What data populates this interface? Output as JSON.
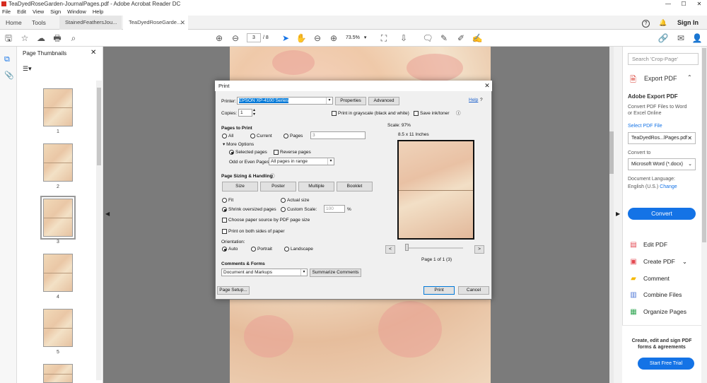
{
  "window": {
    "title": "TeaDyedRoseGarden-JournalPages.pdf - Adobe Acrobat Reader DC",
    "controls": [
      "—",
      "☐",
      "✕"
    ]
  },
  "menu": [
    "File",
    "Edit",
    "View",
    "Sign",
    "Window",
    "Help"
  ],
  "tabs": {
    "home": "Home",
    "tools": "Tools",
    "doc1": "StainedFeathersJou...",
    "doc2": "TeaDyedRoseGarde...",
    "help_icon": "?",
    "signin": "Sign In"
  },
  "toolbar": {
    "page_current": "3",
    "page_total": "/ 8",
    "zoom": "73.5%"
  },
  "thumbnails": {
    "title": "Page Thumbnails",
    "close": "✕",
    "pages": [
      "1",
      "2",
      "3",
      "4",
      "5"
    ]
  },
  "right_panel": {
    "search_placeholder": "Search 'Crop-Page'",
    "export_title": "Export PDF",
    "export_heading": "Adobe Export PDF",
    "export_desc_1": "Convert PDF Files to Word",
    "export_desc_2": "or Excel Online",
    "select_file": "Select PDF File",
    "file_name": "TeaDyedRos...lPages.pdf",
    "convert_to_label": "Convert to",
    "convert_to_value": "Microsoft Word (*.docx)",
    "doc_lang_label": "Document Language:",
    "doc_lang_value": "English (U.S.)",
    "change": "Change",
    "convert_btn": "Convert",
    "tools": [
      "Edit PDF",
      "Create PDF",
      "Comment",
      "Combine Files",
      "Organize Pages"
    ],
    "promo_1": "Create, edit and sign PDF",
    "promo_2": "forms & agreements",
    "start_trial": "Start Free Trial"
  },
  "print_dialog": {
    "title": "Print",
    "printer_label": "Printer:",
    "printer_value": "EPSON XP-4100 Series",
    "properties": "Properties",
    "advanced": "Advanced",
    "help": "Help",
    "copies_label": "Copies:",
    "copies_value": "1",
    "grayscale": "Print in grayscale (black and white)",
    "save_ink": "Save ink/toner",
    "pages_to_print": "Pages to Print",
    "all": "All",
    "current": "Current",
    "pages": "Pages",
    "pages_value": "3",
    "more_options": "More Options",
    "selected_pages": "Selected pages",
    "reverse_pages": "Reverse pages",
    "odd_even_label": "Odd or Even Pages:",
    "odd_even_value": "All pages in range",
    "sizing": "Page Sizing & Handling",
    "size": "Size",
    "poster": "Poster",
    "multiple": "Multiple",
    "booklet": "Booklet",
    "fit": "Fit",
    "actual_size": "Actual size",
    "shrink": "Shrink oversized pages",
    "custom_scale": "Custom Scale:",
    "custom_scale_value": "100",
    "percent": "%",
    "choose_source": "Choose paper source by PDF page size",
    "both_sides": "Print on both sides of paper",
    "orientation": "Orientation:",
    "auto": "Auto",
    "portrait": "Portrait",
    "landscape": "Landscape",
    "comments_forms": "Comments & Forms",
    "comments_value": "Document and Markups",
    "summarize": "Summarize Comments",
    "scale": "Scale: 97%",
    "paper_size": "8.5 x 11 Inches",
    "prev": "<",
    "next": ">",
    "page_of": "Page 1 of 1 (3)",
    "page_setup": "Page Setup...",
    "print": "Print",
    "cancel": "Cancel"
  }
}
